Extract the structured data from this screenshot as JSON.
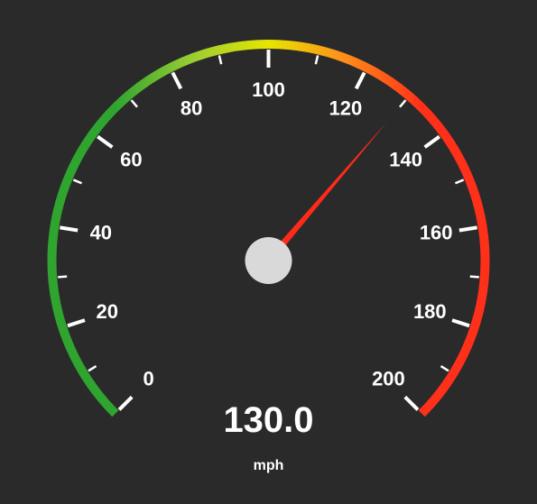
{
  "gauge": {
    "value_display": "130.0",
    "unit": "mph",
    "min": 0,
    "max": 200,
    "value": 130,
    "major_step": 20,
    "minor_step": 10,
    "start_angle_deg": 225,
    "end_angle_deg": -45,
    "tick_labels": [
      "0",
      "20",
      "40",
      "60",
      "80",
      "100",
      "120",
      "140",
      "160",
      "180",
      "200"
    ],
    "arc_colors": {
      "start": "#2fa52f",
      "q1": "#9acd32",
      "mid": "#e6e600",
      "q3": "#ff8c1a",
      "end": "#ff3019"
    },
    "needle_color": "#ff2a1a",
    "hub_color": "#d9d9d9",
    "bg": "#2a2a2a"
  },
  "chart_data": {
    "type": "gauge",
    "title": "",
    "unit": "mph",
    "min": 0,
    "max": 200,
    "value": 130,
    "major_ticks": [
      0,
      20,
      40,
      60,
      80,
      100,
      120,
      140,
      160,
      180,
      200
    ],
    "minor_ticks_step": 10,
    "color_scale": [
      {
        "stop": 0.0,
        "color": "#2fa52f"
      },
      {
        "stop": 0.25,
        "color": "#9acd32"
      },
      {
        "stop": 0.5,
        "color": "#e6e600"
      },
      {
        "stop": 0.75,
        "color": "#ff8c1a"
      },
      {
        "stop": 1.0,
        "color": "#ff3019"
      }
    ]
  }
}
